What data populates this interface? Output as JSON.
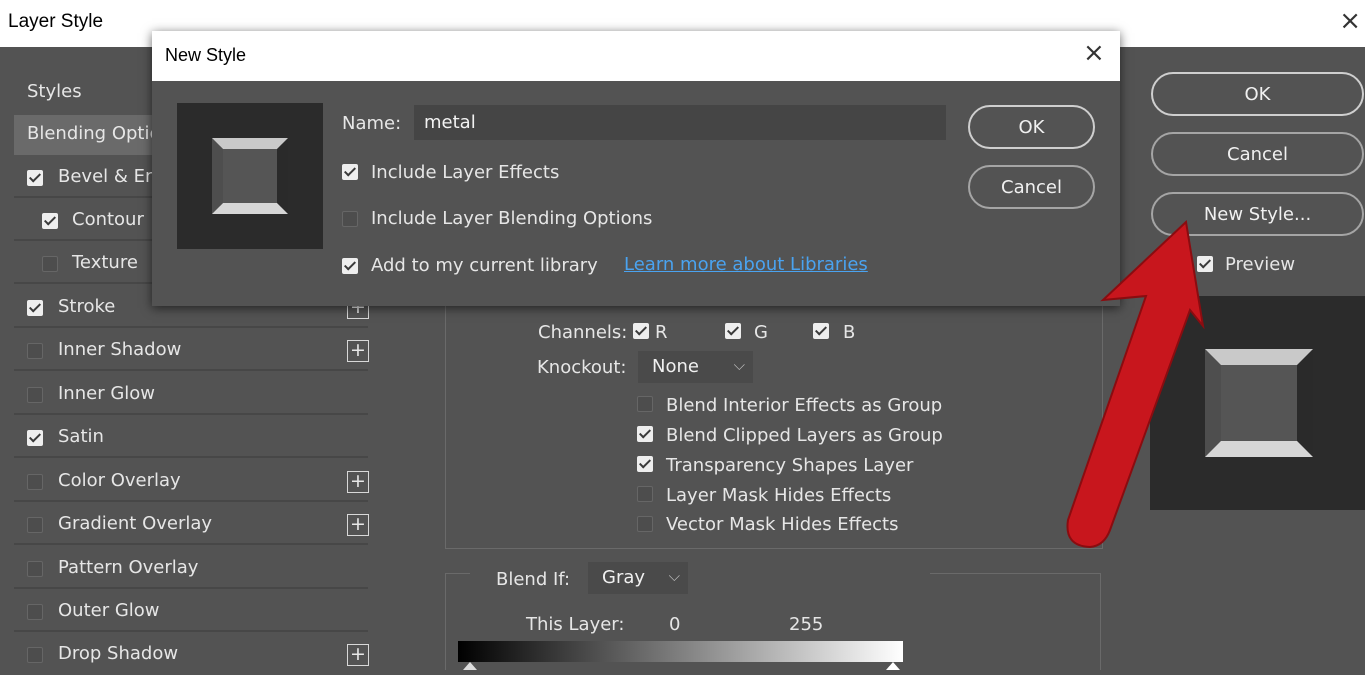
{
  "outer_window": {
    "title": "Layer Style",
    "close_glyph": "×"
  },
  "styles_panel": {
    "header": "Styles",
    "blending_options": "Blending Optic",
    "items": [
      {
        "label": "Bevel & En",
        "checked": true
      },
      {
        "label": "Contour",
        "checked": true
      },
      {
        "label": "Texture",
        "checked": false
      },
      {
        "label": "Stroke",
        "checked": true
      },
      {
        "label": "Inner Shadow",
        "checked": false
      },
      {
        "label": "Inner Glow",
        "checked": false
      },
      {
        "label": "Satin",
        "checked": true
      },
      {
        "label": "Color Overlay",
        "checked": false
      },
      {
        "label": "Gradient Overlay",
        "checked": false
      },
      {
        "label": "Pattern Overlay",
        "checked": false
      },
      {
        "label": "Outer Glow",
        "checked": false
      },
      {
        "label": "Drop Shadow",
        "checked": false
      }
    ],
    "plus_glyph": "+"
  },
  "advanced_blending": {
    "channels_label": "Channels:",
    "channels": [
      {
        "label": "R",
        "checked": true
      },
      {
        "label": "G",
        "checked": true
      },
      {
        "label": "B",
        "checked": true
      }
    ],
    "knockout_label": "Knockout:",
    "knockout_value": "None",
    "options": [
      {
        "label": "Blend Interior Effects as Group",
        "checked": false
      },
      {
        "label": "Blend Clipped Layers as Group",
        "checked": true
      },
      {
        "label": "Transparency Shapes Layer",
        "checked": true
      },
      {
        "label": "Layer Mask Hides Effects",
        "checked": false
      },
      {
        "label": "Vector Mask Hides Effects",
        "checked": false
      }
    ]
  },
  "blend_if": {
    "label": "Blend If:",
    "value": "Gray",
    "this_layer_label": "This Layer:",
    "this_layer_min": "0",
    "this_layer_max": "255"
  },
  "right_panel": {
    "ok_label": "OK",
    "cancel_label": "Cancel",
    "new_style_label": "New Style...",
    "preview_label": "Preview",
    "preview_checked": true
  },
  "new_style_dialog": {
    "title": "New Style",
    "close_glyph": "×",
    "name_label": "Name:",
    "name_value": "metal",
    "include_layer_effects": {
      "label": "Include Layer Effects",
      "checked": true
    },
    "include_blending_options": {
      "label": "Include Layer Blending Options",
      "checked": false
    },
    "add_to_library": {
      "label": "Add to my current library",
      "checked": true
    },
    "learn_more_link": "Learn more about Libraries",
    "ok_label": "OK",
    "cancel_label": "Cancel"
  },
  "annotation": {
    "arrow_color": "#c8161d"
  },
  "chevron_glyph": "⌵"
}
